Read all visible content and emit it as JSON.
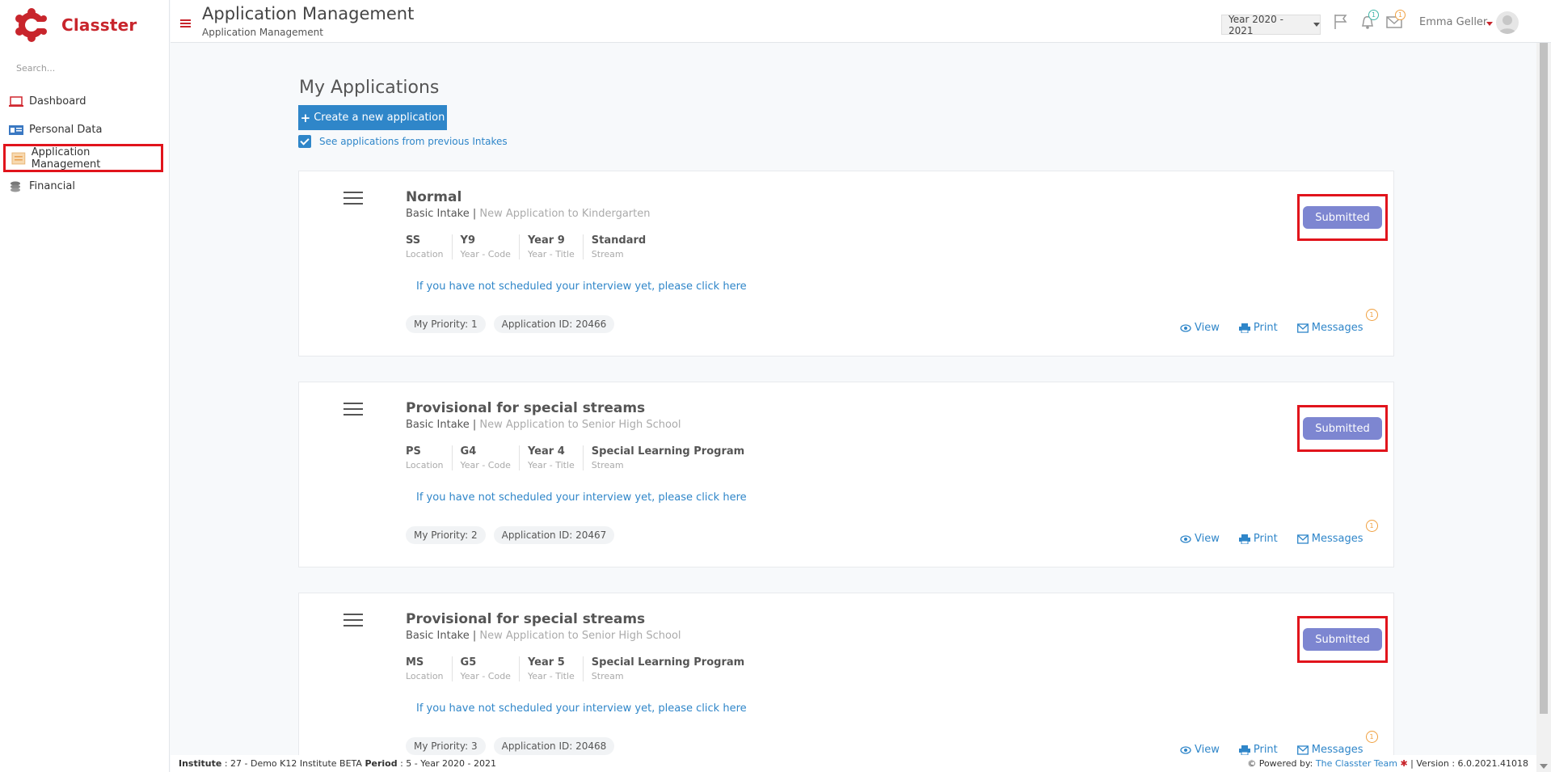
{
  "brand": {
    "name": "Classter",
    "color": "#c8252c"
  },
  "sidebar": {
    "search_placeholder": "Search...",
    "items": [
      {
        "label": "Dashboard",
        "icon": "laptop-icon",
        "active": false
      },
      {
        "label": "Personal Data",
        "icon": "id-card-icon",
        "active": false
      },
      {
        "label": "Application Management",
        "icon": "folder-icon",
        "active": true
      },
      {
        "label": "Financial",
        "icon": "coins-icon",
        "active": false
      }
    ]
  },
  "header": {
    "title": "Application Management",
    "breadcrumb": "Application Management",
    "year": "Year 2020 - 2021",
    "notifications_count": "1",
    "mail_count": "1",
    "user_name": "Emma Geller"
  },
  "main": {
    "heading": "My Applications",
    "create_label": "Create a new application",
    "prev_intakes_label": "See applications from previous Intakes",
    "field_labels": {
      "location": "Location",
      "year_code": "Year - Code",
      "year_title": "Year - Title",
      "stream": "Stream"
    },
    "interview_link": "If you have not scheduled your interview yet, please click here",
    "actions": {
      "view": "View",
      "print": "Print",
      "messages": "Messages"
    },
    "applications": [
      {
        "title": "Normal",
        "intake": "Basic Intake",
        "program": "New Application to Kindergarten",
        "location": "SS",
        "year_code": "Y9",
        "year_title": "Year 9",
        "stream": "Standard",
        "priority": "My Priority: 1",
        "app_id": "Application ID: 20466",
        "status": "Submitted",
        "messages_count": "1"
      },
      {
        "title": "Provisional for special streams",
        "intake": "Basic Intake",
        "program": "New Application to Senior High School",
        "location": "PS",
        "year_code": "G4",
        "year_title": "Year 4",
        "stream": "Special Learning Program",
        "priority": "My Priority: 2",
        "app_id": "Application ID: 20467",
        "status": "Submitted",
        "messages_count": "1"
      },
      {
        "title": "Provisional for special streams",
        "intake": "Basic Intake",
        "program": "New Application to Senior High School",
        "location": "MS",
        "year_code": "G5",
        "year_title": "Year 5",
        "stream": "Special Learning Program",
        "priority": "My Priority: 3",
        "app_id": "Application ID: 20468",
        "status": "Submitted",
        "messages_count": "1"
      }
    ]
  },
  "footer": {
    "institute_label": "Institute",
    "institute_value": ": 27 - Demo K12 Institute BETA",
    "period_label": "Period",
    "period_value": ": 5 - Year 2020 - 2021",
    "powered_by": "Powered by:",
    "team": "The Classter Team",
    "version": "| Version : 6.0.2021.41018"
  },
  "colors": {
    "accent": "#2f86c9",
    "status": "#7d86d1",
    "highlight": "#e1141c"
  }
}
